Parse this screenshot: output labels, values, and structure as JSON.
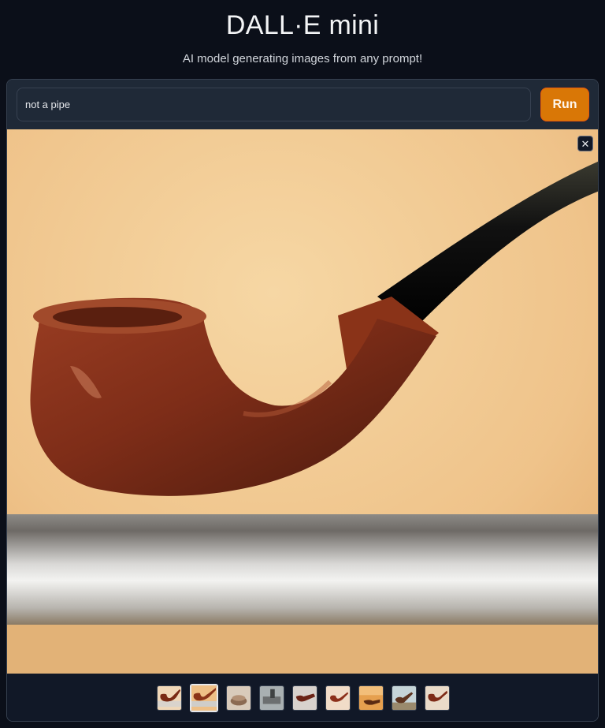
{
  "header": {
    "title": "DALL·E mini",
    "subtitle": "AI model generating images from any prompt!"
  },
  "prompt": {
    "value": "not a pipe",
    "placeholder": ""
  },
  "run_button": {
    "label": "Run"
  },
  "gallery": {
    "close_icon": "close-icon",
    "close_glyph": "✕",
    "selected_index": 1,
    "thumbnail_count": 9,
    "colors": {
      "background": "#0b0f19",
      "panel": "#111827",
      "accent": "#d97706"
    }
  }
}
